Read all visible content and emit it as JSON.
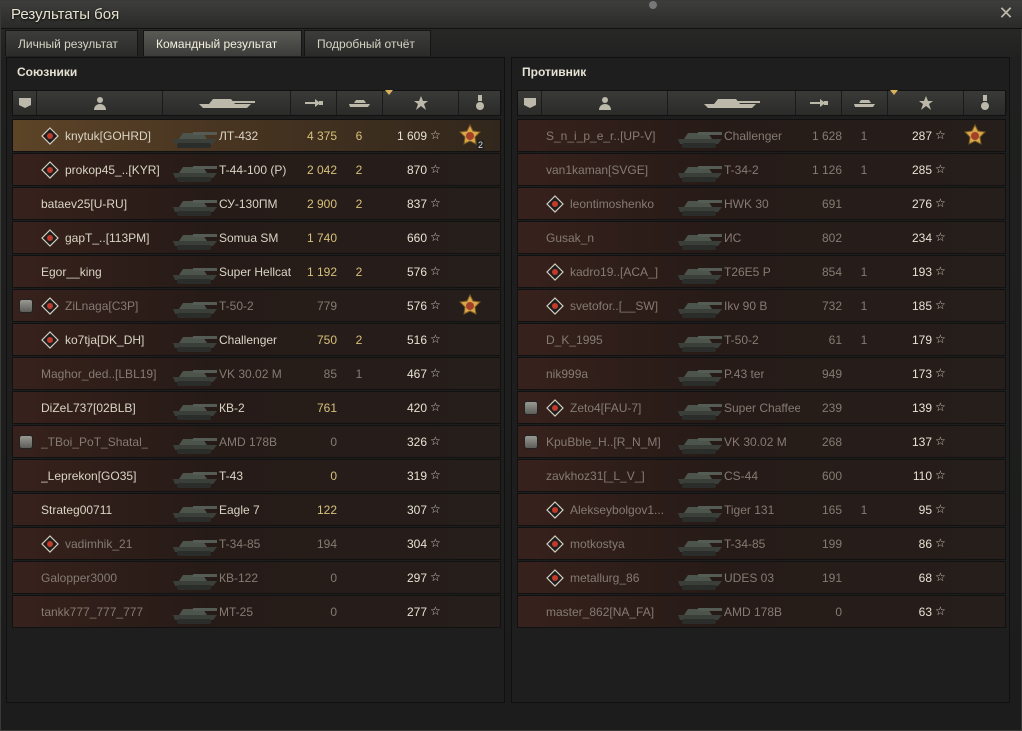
{
  "window": {
    "title": "Результаты боя"
  },
  "tabs": [
    {
      "label": "Личный результат",
      "active": false
    },
    {
      "label": "Командный результат",
      "active": true
    },
    {
      "label": "Подробный отчёт",
      "active": false
    }
  ],
  "allies": {
    "title": "Союзники",
    "rows": [
      {
        "platoon": false,
        "badge": "rank-badge-icon",
        "name": "knytuk[GOHRD]",
        "vehicle": "ЛТ-432",
        "damage": "4 375",
        "kills": "6",
        "xp": "1 609",
        "medal": "medal-icon",
        "medal_count": "2",
        "highlight": true,
        "dead": false
      },
      {
        "platoon": false,
        "badge": "rank-badge-icon",
        "name": "prokop45_..[KYR]",
        "vehicle": "T-44-100 (P)",
        "damage": "2 042",
        "kills": "2",
        "xp": "870",
        "medal": "",
        "medal_count": "",
        "highlight": false,
        "dead": false
      },
      {
        "platoon": false,
        "badge": "",
        "name": "bataev25[U-RU]",
        "vehicle": "СУ-130ПМ",
        "damage": "2 900",
        "kills": "2",
        "xp": "837",
        "medal": "",
        "medal_count": "",
        "highlight": false,
        "dead": false
      },
      {
        "platoon": false,
        "badge": "rank-badge-icon",
        "name": "gapT_..[113PM]",
        "vehicle": "Somua SM",
        "damage": "1 740",
        "kills": "",
        "xp": "660",
        "medal": "",
        "medal_count": "",
        "highlight": false,
        "dead": false
      },
      {
        "platoon": false,
        "badge": "",
        "name": "Egor__king",
        "vehicle": "Super Hellcat",
        "damage": "1 192",
        "kills": "2",
        "xp": "576",
        "medal": "",
        "medal_count": "",
        "highlight": false,
        "dead": false
      },
      {
        "platoon": true,
        "badge": "rank-badge-icon",
        "name": "ZiLnaga[C3P]",
        "vehicle": "T-50-2",
        "damage": "779",
        "kills": "",
        "xp": "576",
        "medal": "medal-icon",
        "medal_count": "",
        "highlight": false,
        "dead": true
      },
      {
        "platoon": false,
        "badge": "rank-badge-icon",
        "name": "ko7tja[DK_DH]",
        "vehicle": "Challenger",
        "damage": "750",
        "kills": "2",
        "xp": "516",
        "medal": "",
        "medal_count": "",
        "highlight": false,
        "dead": false
      },
      {
        "platoon": false,
        "badge": "",
        "name": "Maghor_ded..[LBL19]",
        "vehicle": "VK 30.02 M",
        "damage": "85",
        "kills": "1",
        "xp": "467",
        "medal": "",
        "medal_count": "",
        "highlight": false,
        "dead": true
      },
      {
        "platoon": false,
        "badge": "",
        "name": "DiZeL737[02BLB]",
        "vehicle": "КВ-2",
        "damage": "761",
        "kills": "",
        "xp": "420",
        "medal": "",
        "medal_count": "",
        "highlight": false,
        "dead": false
      },
      {
        "platoon": true,
        "badge": "",
        "name": "_TBoi_PoT_Shatal_",
        "vehicle": "AMD 178B",
        "damage": "0",
        "kills": "",
        "xp": "326",
        "medal": "",
        "medal_count": "",
        "highlight": false,
        "dead": true
      },
      {
        "platoon": false,
        "badge": "",
        "name": "_Leprekon[GO35]",
        "vehicle": "T-43",
        "damage": "0",
        "kills": "",
        "xp": "319",
        "medal": "",
        "medal_count": "",
        "highlight": false,
        "dead": false
      },
      {
        "platoon": false,
        "badge": "",
        "name": "Strateg00711",
        "vehicle": "Eagle 7",
        "damage": "122",
        "kills": "",
        "xp": "307",
        "medal": "",
        "medal_count": "",
        "highlight": false,
        "dead": false
      },
      {
        "platoon": false,
        "badge": "rank-badge-icon",
        "name": "vadimhik_21",
        "vehicle": "T-34-85",
        "damage": "194",
        "kills": "",
        "xp": "304",
        "medal": "",
        "medal_count": "",
        "highlight": false,
        "dead": true
      },
      {
        "platoon": false,
        "badge": "",
        "name": "Galopper3000",
        "vehicle": "КВ-122",
        "damage": "0",
        "kills": "",
        "xp": "297",
        "medal": "",
        "medal_count": "",
        "highlight": false,
        "dead": true
      },
      {
        "platoon": false,
        "badge": "",
        "name": "tankk777_777_777",
        "vehicle": "MT-25",
        "damage": "0",
        "kills": "",
        "xp": "277",
        "medal": "",
        "medal_count": "",
        "highlight": false,
        "dead": true
      }
    ]
  },
  "enemies": {
    "title": "Противник",
    "rows": [
      {
        "platoon": false,
        "badge": "",
        "name": "S_n_i_p_e_r..[UP-V]",
        "vehicle": "Challenger",
        "damage": "1 628",
        "kills": "1",
        "xp": "287",
        "medal": "medal-icon",
        "medal_count": "",
        "highlight": false,
        "dead": true
      },
      {
        "platoon": false,
        "badge": "",
        "name": "van1kaman[SVGE]",
        "vehicle": "T-34-2",
        "damage": "1 126",
        "kills": "1",
        "xp": "285",
        "medal": "",
        "medal_count": "",
        "highlight": false,
        "dead": true
      },
      {
        "platoon": false,
        "badge": "rank-badge-icon",
        "name": "leontimoshenko",
        "vehicle": "HWK 30",
        "damage": "691",
        "kills": "",
        "xp": "276",
        "medal": "",
        "medal_count": "",
        "highlight": false,
        "dead": true
      },
      {
        "platoon": false,
        "badge": "",
        "name": "Gusak_n",
        "vehicle": "ИС",
        "damage": "802",
        "kills": "",
        "xp": "234",
        "medal": "",
        "medal_count": "",
        "highlight": false,
        "dead": true
      },
      {
        "platoon": false,
        "badge": "rank-badge-icon",
        "name": "kadro19..[ACA_]",
        "vehicle": "T26E5 P",
        "damage": "854",
        "kills": "1",
        "xp": "193",
        "medal": "",
        "medal_count": "",
        "highlight": false,
        "dead": true
      },
      {
        "platoon": false,
        "badge": "rank-badge-icon",
        "name": "svetofor..[__SW]",
        "vehicle": "Ikv 90 B",
        "damage": "732",
        "kills": "1",
        "xp": "185",
        "medal": "",
        "medal_count": "",
        "highlight": false,
        "dead": true
      },
      {
        "platoon": false,
        "badge": "",
        "name": "D_K_1995",
        "vehicle": "T-50-2",
        "damage": "61",
        "kills": "1",
        "xp": "179",
        "medal": "",
        "medal_count": "",
        "highlight": false,
        "dead": true
      },
      {
        "platoon": false,
        "badge": "",
        "name": "nik999a",
        "vehicle": "P.43 ter",
        "damage": "949",
        "kills": "",
        "xp": "173",
        "medal": "",
        "medal_count": "",
        "highlight": false,
        "dead": true
      },
      {
        "platoon": true,
        "badge": "rank-badge-icon",
        "name": "Zeto4[FAU-7]",
        "vehicle": "Super Chaffee",
        "damage": "239",
        "kills": "",
        "xp": "139",
        "medal": "",
        "medal_count": "",
        "highlight": false,
        "dead": true
      },
      {
        "platoon": true,
        "badge": "",
        "name": "KpuBble_H..[R_N_M]",
        "vehicle": "VK 30.02 M",
        "damage": "268",
        "kills": "",
        "xp": "137",
        "medal": "",
        "medal_count": "",
        "highlight": false,
        "dead": true
      },
      {
        "platoon": false,
        "badge": "",
        "name": "zavkhoz31[_L_V_]",
        "vehicle": "CS-44",
        "damage": "600",
        "kills": "",
        "xp": "110",
        "medal": "",
        "medal_count": "",
        "highlight": false,
        "dead": true
      },
      {
        "platoon": false,
        "badge": "rank-badge-icon",
        "name": "Alekseybolgov1...",
        "vehicle": "Tiger 131",
        "damage": "165",
        "kills": "1",
        "xp": "95",
        "medal": "",
        "medal_count": "",
        "highlight": false,
        "dead": true
      },
      {
        "platoon": false,
        "badge": "rank-badge-icon",
        "name": "motkostya",
        "vehicle": "T-34-85",
        "damage": "199",
        "kills": "",
        "xp": "86",
        "medal": "",
        "medal_count": "",
        "highlight": false,
        "dead": true
      },
      {
        "platoon": false,
        "badge": "rank-badge-icon",
        "name": "metallurg_86",
        "vehicle": "UDES 03",
        "damage": "191",
        "kills": "",
        "xp": "68",
        "medal": "",
        "medal_count": "",
        "highlight": false,
        "dead": true
      },
      {
        "platoon": false,
        "badge": "",
        "name": "master_862[NA_FA]",
        "vehicle": "AMD 178B",
        "damage": "0",
        "kills": "",
        "xp": "63",
        "medal": "",
        "medal_count": "",
        "highlight": false,
        "dead": true
      }
    ]
  },
  "columns": [
    {
      "icon": "platoon-icon"
    },
    {
      "icon": "player-icon"
    },
    {
      "icon": "tank-icon"
    },
    {
      "icon": "damage-icon"
    },
    {
      "icon": "kills-icon"
    },
    {
      "icon": "xp-star-icon"
    },
    {
      "icon": "medal-column-icon"
    }
  ],
  "colors": {
    "accent": "#d8b35a",
    "damage": "#d7c07a",
    "text": "#d9d5c5"
  }
}
